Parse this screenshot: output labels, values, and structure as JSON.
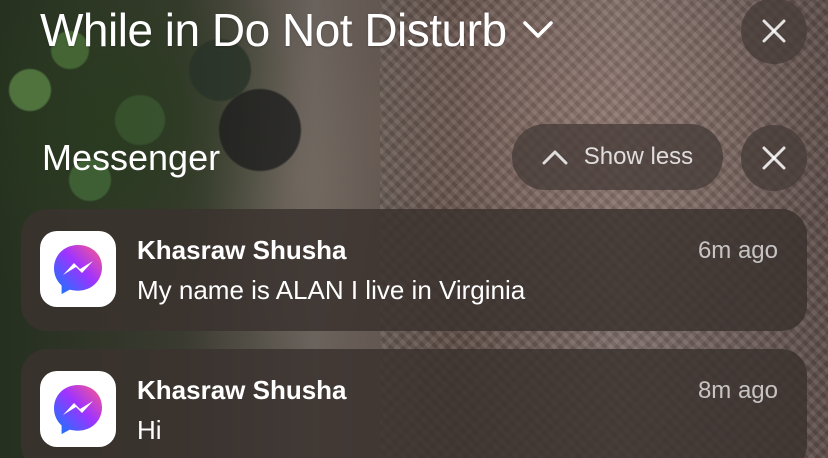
{
  "header": {
    "title": "While in Do Not Disturb",
    "chevron_icon": "chevron-down-icon",
    "close_icon": "close-icon"
  },
  "group": {
    "app_name": "Messenger",
    "show_less_label": "Show less",
    "show_less_icon": "chevron-up-icon",
    "close_icon": "close-icon"
  },
  "notifications": [
    {
      "app_icon": "messenger-icon",
      "sender": "Khasraw Shusha",
      "time": "6m ago",
      "message": "My name is ALAN I live in Virginia"
    },
    {
      "app_icon": "messenger-icon",
      "sender": "Khasraw Shusha",
      "time": "8m ago",
      "message": "Hi"
    }
  ],
  "colors": {
    "messenger_gradient_start": "#0a7cff",
    "messenger_gradient_mid": "#a033ff",
    "messenger_gradient_end": "#ff5c87"
  }
}
